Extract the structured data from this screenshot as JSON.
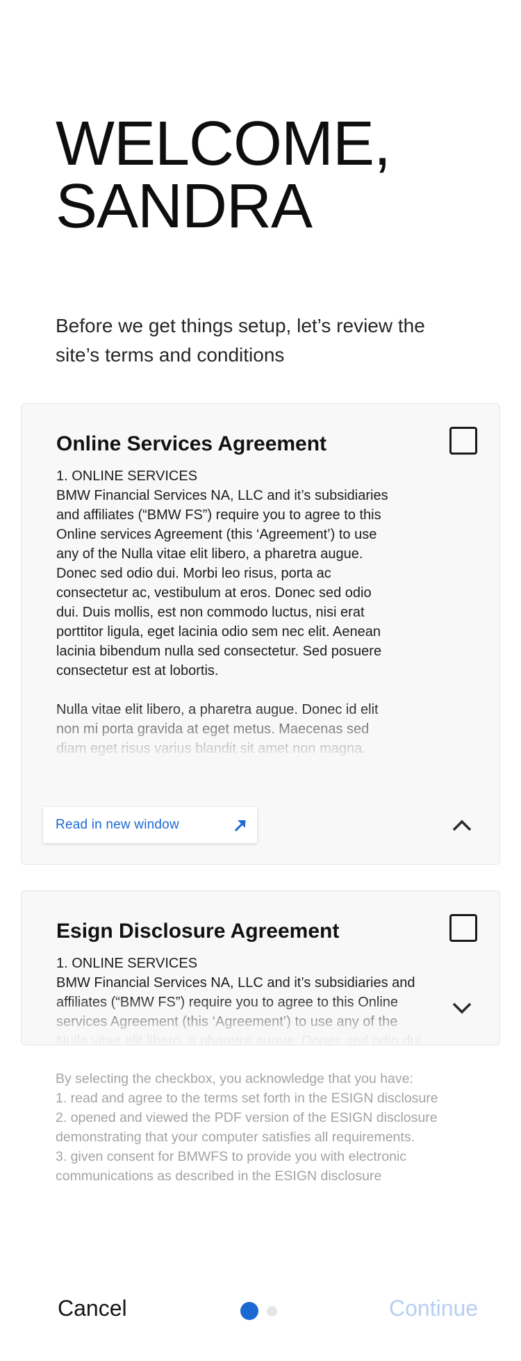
{
  "header": {
    "title_line1": "WELCOME,",
    "title_line2": "SANDRA",
    "intro": "Before we get things setup, let’s review the site’s terms and conditions"
  },
  "online_services_card": {
    "title": "Online Services Agreement",
    "section_heading": "1. ONLINE SERVICES",
    "paragraph1": "BMW Financial Services NA, LLC and it’s subsidiaries and affiliates (“BMW FS”) require you to agree to this Online services Agreement (this ‘Agreement’) to use any of the Nulla vitae elit libero, a pharetra augue. Donec sed odio dui. Morbi leo risus, porta ac consectetur ac, vestibulum at eros. Donec sed odio dui. Duis mollis, est non commodo luctus, nisi erat porttitor ligula, eget lacinia odio sem nec elit. Aenean lacinia bibendum nulla sed consectetur. Sed posuere consectetur est at lobortis.",
    "paragraph2": "Nulla vitae elit libero, a pharetra augue. Donec id elit non mi porta gravida at eget metus. Maecenas sed diam eget risus varius blandit sit amet non magna.",
    "read_link_label": "Read in new window",
    "checked": false,
    "expanded": true
  },
  "esign_card": {
    "title": "Esign Disclosure Agreement",
    "section_heading": "1. ONLINE SERVICES",
    "paragraph1": "BMW Financial Services NA, LLC and it’s subsidiaries and affiliates (“BMW FS”) require you to agree to this Online services Agreement (this ‘Agreement’) to use any of the Nulla vitae elit libero, a pharetra augue. Donec sed odio dui.",
    "checked": false,
    "expanded": false
  },
  "acknowledgement": {
    "intro": "By selecting the checkbox, you acknowledge that you have:",
    "item1": "1. read and agree to the terms set forth in the ESIGN disclosure",
    "item2": "2. opened and viewed the PDF version of the ESIGN disclosure demonstrating that your computer satisfies all requirements.",
    "item3": "3. given consent for BMWFS to provide you with electronic communications as described in the ESIGN disclosure"
  },
  "footer": {
    "cancel_label": "Cancel",
    "continue_label": "Continue",
    "current_step": 1,
    "total_steps": 2
  },
  "colors": {
    "accent": "#1c69d4",
    "continue_disabled": "#b6cff2",
    "muted_text": "#a3a3a3",
    "card_bg": "#f8f8f8"
  },
  "icons": {
    "external_link": "arrow-up-right-icon",
    "collapse": "chevron-up-icon",
    "expand": "chevron-down-icon"
  }
}
